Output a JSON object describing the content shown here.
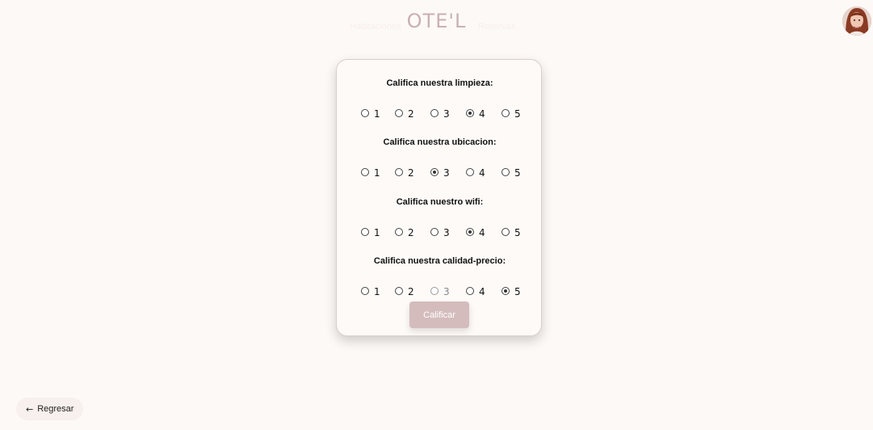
{
  "header": {
    "brand": "OTE'L",
    "nav_left": "Habitaciones",
    "nav_right": "Reservas",
    "avatar_icon": "user-avatar"
  },
  "rating_form": {
    "questions": [
      {
        "label": "Califica nuestra limpieza:",
        "options": [
          "1",
          "2",
          "3",
          "4",
          "5"
        ],
        "selected": "4"
      },
      {
        "label": "Califica nuestra ubicacion:",
        "options": [
          "1",
          "2",
          "3",
          "4",
          "5"
        ],
        "selected": "3"
      },
      {
        "label": "Califica nuestro wifi:",
        "options": [
          "1",
          "2",
          "3",
          "4",
          "5"
        ],
        "selected": "4"
      },
      {
        "label": "Califica nuestra calidad-precio:",
        "options": [
          "1",
          "2",
          "3",
          "4",
          "5"
        ],
        "selected": "5"
      }
    ],
    "submit_label": "Calificar"
  },
  "footer": {
    "back_icon": "arrow-left-icon",
    "back_label": "Regresar"
  },
  "colors": {
    "background": "#fdf9f7",
    "brand": "#c9b0b3",
    "button": "#d4bcbd"
  }
}
